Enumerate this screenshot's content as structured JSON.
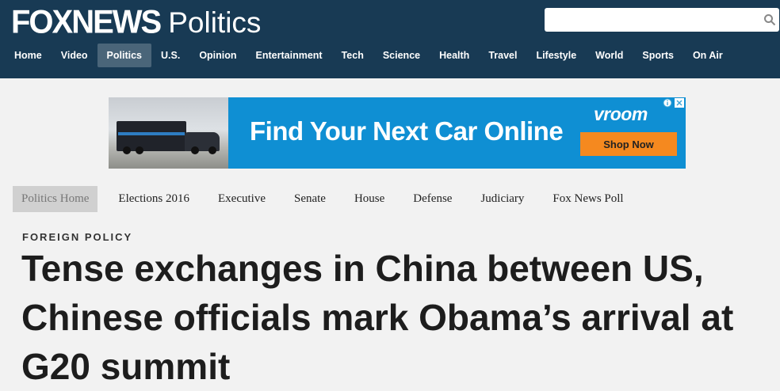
{
  "header": {
    "logo_text": "FOXNEWS",
    "section_title": "Politics",
    "search": {
      "placeholder": ""
    },
    "icons": {
      "search": "search-icon"
    }
  },
  "topnav": {
    "items": [
      {
        "label": "Home"
      },
      {
        "label": "Video"
      },
      {
        "label": "Politics",
        "active": true
      },
      {
        "label": "U.S."
      },
      {
        "label": "Opinion"
      },
      {
        "label": "Entertainment"
      },
      {
        "label": "Tech"
      },
      {
        "label": "Science"
      },
      {
        "label": "Health"
      },
      {
        "label": "Travel"
      },
      {
        "label": "Lifestyle"
      },
      {
        "label": "World"
      },
      {
        "label": "Sports"
      },
      {
        "label": "On Air"
      }
    ]
  },
  "ad": {
    "headline": "Find Your Next Car Online",
    "brand": "vroom",
    "cta": "Shop Now",
    "icons": {
      "info": "info-icon",
      "close": "close-icon"
    }
  },
  "subnav": {
    "items": [
      {
        "label": "Politics Home",
        "active": true
      },
      {
        "label": "Elections 2016"
      },
      {
        "label": "Executive"
      },
      {
        "label": "Senate"
      },
      {
        "label": "House"
      },
      {
        "label": "Defense"
      },
      {
        "label": "Judiciary"
      },
      {
        "label": "Fox News Poll"
      }
    ]
  },
  "article": {
    "kicker": "FOREIGN POLICY",
    "headline": "Tense exchanges in China between US, Chinese officials mark Obama’s arrival at G20 summit"
  },
  "colors": {
    "header_bg": "#183a54",
    "nav_active": "#4a6579",
    "ad_bg": "#0f8fd3",
    "cta": "#f5891f",
    "page_bg": "#f2f2f2"
  }
}
